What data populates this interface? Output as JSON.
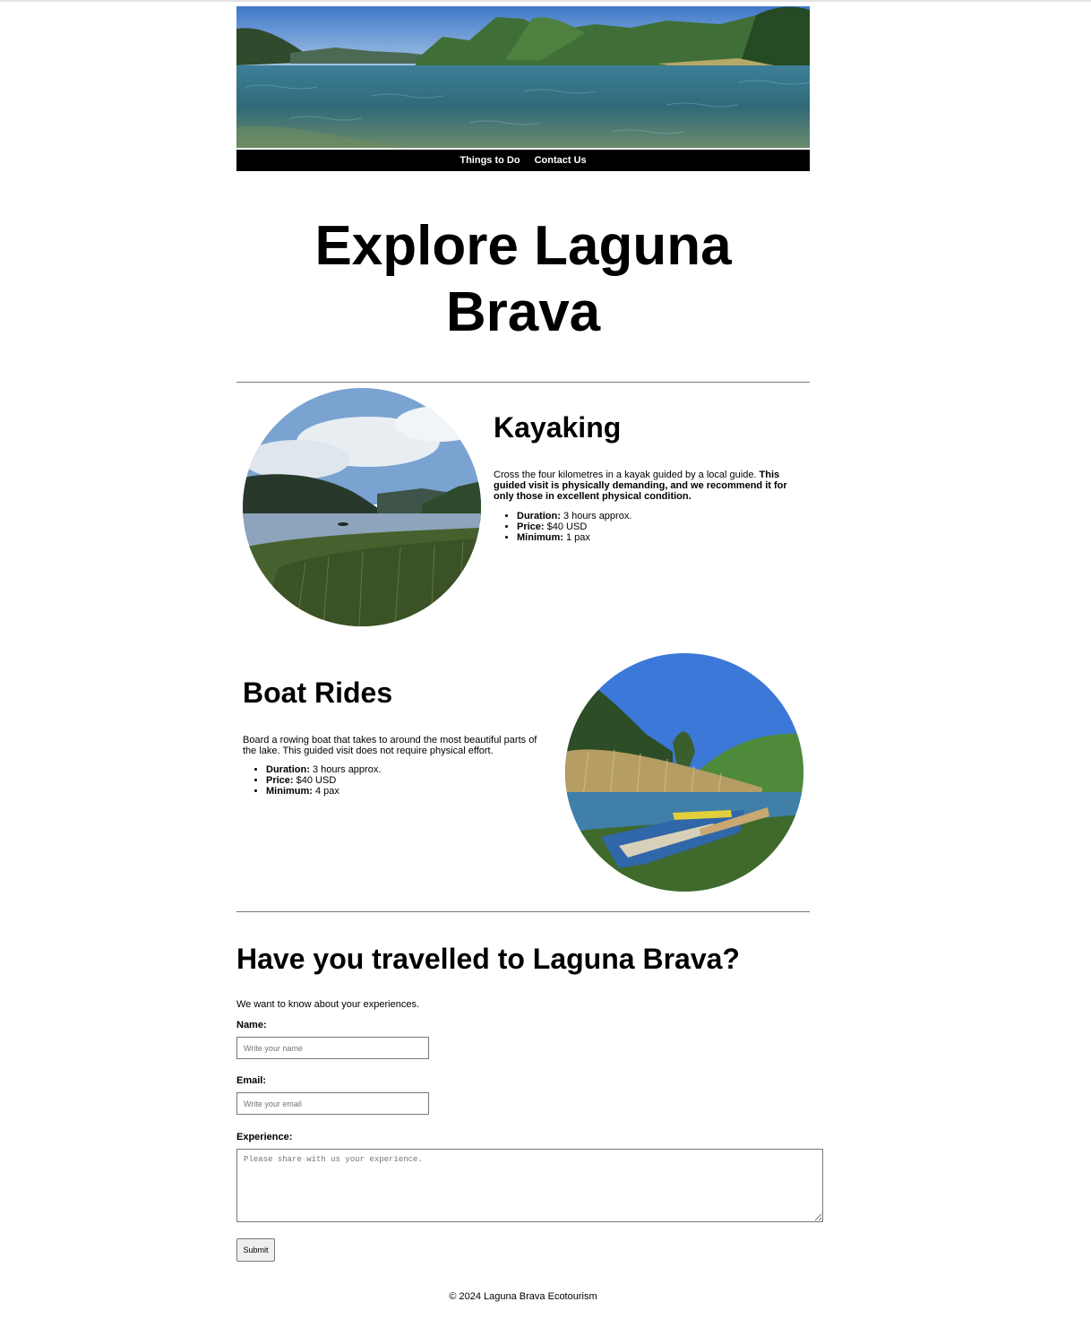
{
  "nav": {
    "items": [
      "Things to Do",
      "Contact Us"
    ]
  },
  "hero": {
    "title": "Explore Laguna Brava"
  },
  "activities": [
    {
      "title": "Kayaking",
      "desc_plain": "Cross the four kilometres in a kayak guided by a local guide. ",
      "desc_bold": "This guided visit is physically demanding, and we recommend it for only those in excellent physical condition.",
      "facts": [
        {
          "label": "Duration:",
          "value": " 3 hours approx."
        },
        {
          "label": "Price:",
          "value": " $40 USD"
        },
        {
          "label": "Minimum:",
          "value": " 1 pax"
        }
      ]
    },
    {
      "title": "Boat Rides",
      "desc_plain": "Board a rowing boat that takes to around the most beautiful parts of the lake. This guided visit does not require physical effort.",
      "facts": [
        {
          "label": "Duration:",
          "value": " 3 hours approx."
        },
        {
          "label": "Price:",
          "value": " $40 USD"
        },
        {
          "label": "Minimum:",
          "value": " 4 pax"
        }
      ]
    }
  ],
  "form": {
    "heading": "Have you travelled to Laguna Brava?",
    "intro": "We want to know about your experiences.",
    "name_label": "Name:",
    "name_placeholder": "Write your name",
    "email_label": "Email:",
    "email_placeholder": "Write your email",
    "experience_label": "Experience:",
    "experience_placeholder": "Please share with us your experience.",
    "submit_label": "Submit"
  },
  "footer": {
    "text": "© 2024 Laguna Brava Ecotourism"
  }
}
